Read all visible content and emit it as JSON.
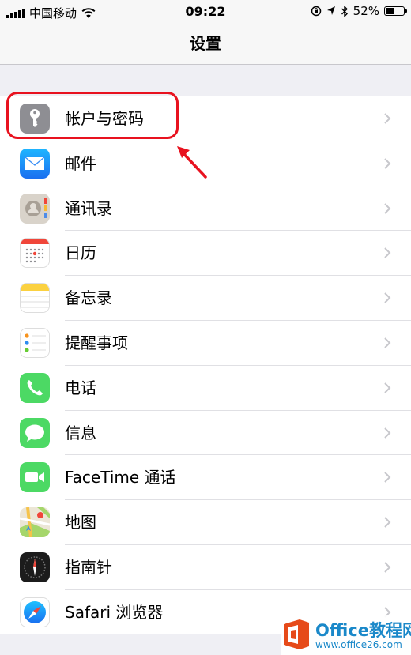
{
  "status_bar": {
    "carrier": "中国移动",
    "time": "09:22",
    "battery": "52%",
    "battery_level": 0.52,
    "icons": [
      "signal-icon",
      "wifi-icon",
      "orientation-lock-icon",
      "location-icon",
      "bluetooth-icon",
      "battery-icon"
    ]
  },
  "nav": {
    "title": "设置"
  },
  "settings_items": [
    {
      "label": "帐户与密码",
      "icon": "key-icon",
      "color": "#8e8e93"
    },
    {
      "label": "邮件",
      "icon": "mail-icon",
      "color": "#1e8cf0"
    },
    {
      "label": "通讯录",
      "icon": "contacts-icon",
      "color": "#cdc6bd"
    },
    {
      "label": "日历",
      "icon": "calendar-icon",
      "color": "#ffffff"
    },
    {
      "label": "备忘录",
      "icon": "notes-icon",
      "color": "#fbd140"
    },
    {
      "label": "提醒事项",
      "icon": "reminders-icon",
      "color": "#ffffff"
    },
    {
      "label": "电话",
      "icon": "phone-icon",
      "color": "#4cd964"
    },
    {
      "label": "信息",
      "icon": "messages-icon",
      "color": "#4cd964"
    },
    {
      "label": "FaceTime 通话",
      "icon": "facetime-icon",
      "color": "#4cd964"
    },
    {
      "label": "地图",
      "icon": "maps-icon",
      "color": "#e9e4d6"
    },
    {
      "label": "指南针",
      "icon": "compass-icon",
      "color": "#1c1c1c"
    },
    {
      "label": "Safari 浏览器",
      "icon": "safari-icon",
      "color": "#1e8cf0"
    }
  ],
  "annotation": {
    "color": "#e8121f"
  },
  "watermark": {
    "title": "Office教程网",
    "url": "www.office26.com"
  }
}
